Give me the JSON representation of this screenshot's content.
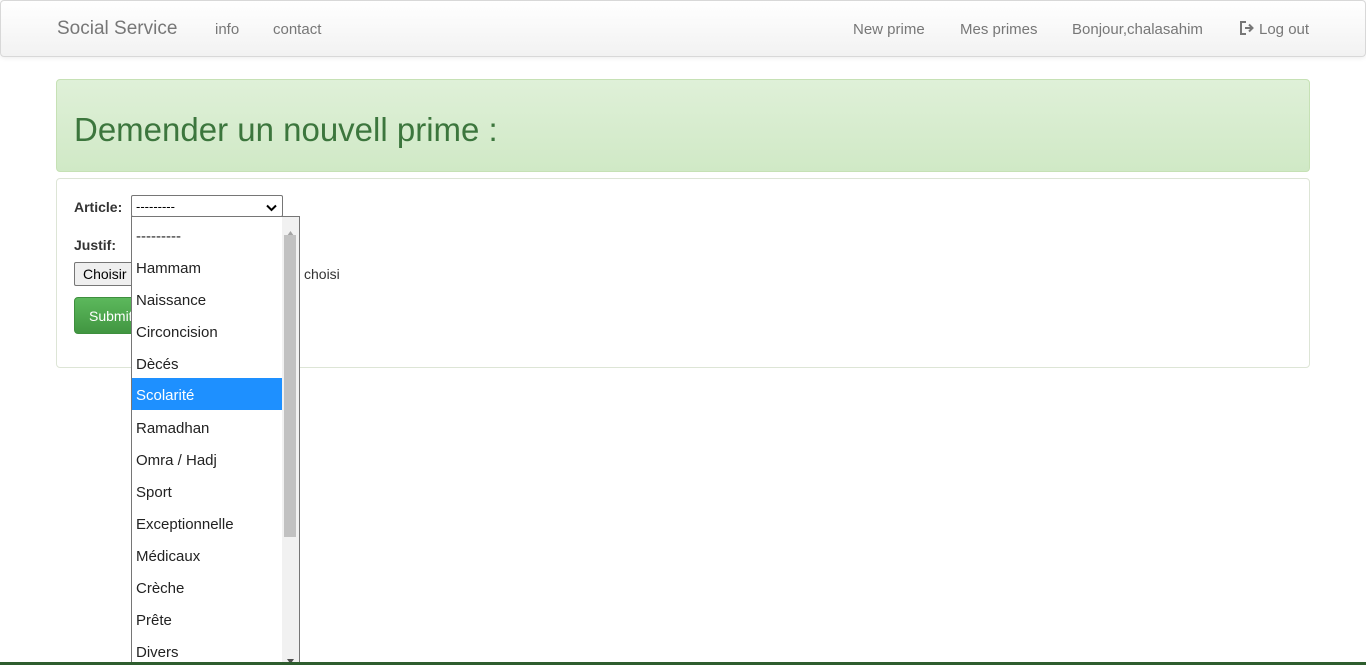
{
  "navbar": {
    "brand": "Social Service",
    "left_links": [
      "info",
      "contact"
    ],
    "right_links": [
      "New prime",
      "Mes primes",
      "Bonjour,chalasahim"
    ],
    "logout_label": "Log out",
    "logout_icon": "log-out-icon"
  },
  "banner": {
    "title": "Demender un nouvell prime :"
  },
  "form": {
    "article_label": "Article:",
    "article_value": "---------",
    "justif_label": "Justif:",
    "file_button_label": "Choisir un fichier",
    "file_status": "choisi",
    "submit_label": "Submit"
  },
  "dropdown": {
    "options": [
      "---------",
      "Hammam",
      "Naissance",
      "Circoncision",
      "Dècés",
      "Scolarité",
      "Ramadhan",
      "Omra / Hadj",
      "Sport",
      "Exceptionnelle",
      "Médicaux",
      "Crèche",
      "Prête",
      "Divers"
    ],
    "highlighted": "Scolarité"
  },
  "colors": {
    "banner_text": "#3c763d",
    "banner_bg": "#dff0d8",
    "submit_bg": "#5cb85c",
    "highlight": "#1e90ff"
  }
}
